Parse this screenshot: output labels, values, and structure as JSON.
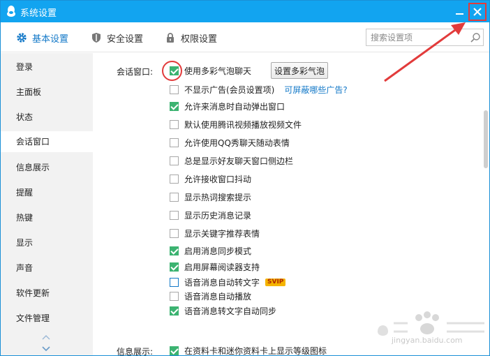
{
  "window": {
    "title": "系统设置"
  },
  "toolbar": {
    "tabs": [
      {
        "label": "基本设置",
        "icon": "gear-icon",
        "active": true
      },
      {
        "label": "安全设置",
        "icon": "shield-icon",
        "active": false
      },
      {
        "label": "权限设置",
        "icon": "lock-icon",
        "active": false
      }
    ],
    "search_placeholder": "搜索设置项"
  },
  "sidebar": {
    "items": [
      {
        "label": "登录"
      },
      {
        "label": "主面板"
      },
      {
        "label": "状态"
      },
      {
        "label": "会话窗口",
        "active": true
      },
      {
        "label": "信息展示"
      },
      {
        "label": "提醒"
      },
      {
        "label": "热键"
      },
      {
        "label": "显示"
      },
      {
        "label": "声音"
      },
      {
        "label": "软件更新"
      },
      {
        "label": "文件管理"
      }
    ]
  },
  "content": {
    "section_chat": "会话窗口:",
    "bubble_button": "设置多彩气泡",
    "options": [
      {
        "label": "使用多彩气泡聊天",
        "checked": true
      },
      {
        "label": "不显示广告(会员设置项)",
        "checked": false,
        "link": "可屏蔽哪些广告?"
      },
      {
        "label": "允许来消息时自动弹出窗口",
        "checked": true
      },
      {
        "label": "默认使用腾讯视频播放视频文件",
        "checked": false
      },
      {
        "label": "允许使用QQ秀聊天随动表情",
        "checked": false
      },
      {
        "label": "总是显示好友聊天窗口侧边栏",
        "checked": false
      },
      {
        "label": "允许接收窗口抖动",
        "checked": false
      },
      {
        "label": "显示热词搜索提示",
        "checked": false
      },
      {
        "label": "显示历史消息记录",
        "checked": false
      },
      {
        "label": "显示关键字推荐表情",
        "checked": false
      },
      {
        "label": "启用消息同步模式",
        "checked": true
      },
      {
        "label": "启用屏幕阅读器支持",
        "checked": true
      },
      {
        "label": "语音消息自动转文字",
        "checked": false,
        "badge": "SVIP"
      },
      {
        "label": "语音消息自动播放",
        "checked": false
      },
      {
        "label": "语音消息转文字自动同步",
        "checked": true
      }
    ],
    "section_info": "信息展示:",
    "info_option": {
      "label": "在资料卡和迷你资料卡上显示等级图标",
      "checked": true
    }
  },
  "watermark": {
    "text": "jingyan.baidu.com"
  },
  "colors": {
    "titlebar": "#12a4f0",
    "accent": "#1479c8",
    "check": "#3cb371",
    "highlight": "#e23b3b"
  }
}
